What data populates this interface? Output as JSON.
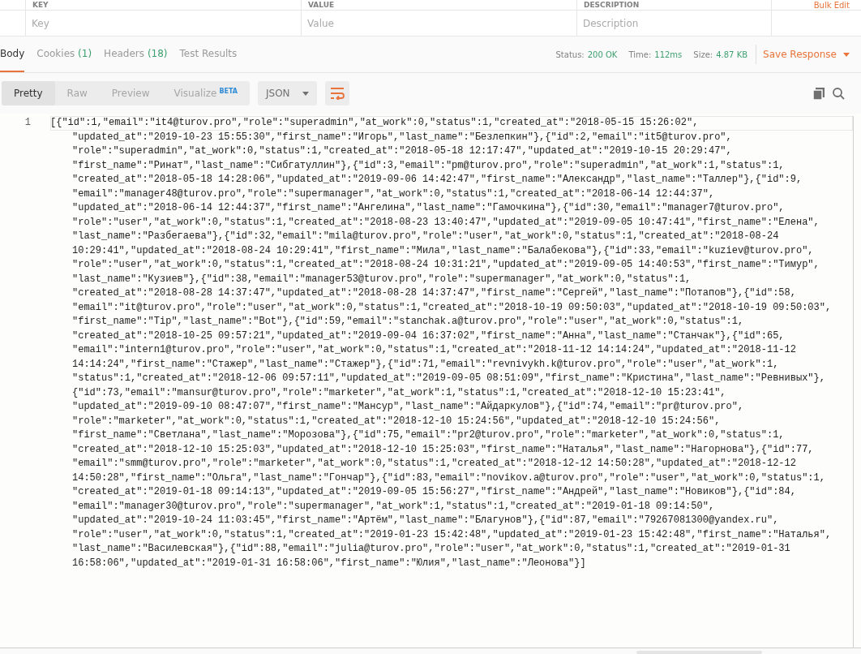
{
  "params_table": {
    "columns": [
      "KEY",
      "VALUE",
      "DESCRIPTION"
    ],
    "bulk_edit": "Bulk Edit",
    "placeholders": [
      "Key",
      "Value",
      "Description"
    ]
  },
  "response_tabs": [
    {
      "label": "Body",
      "selected": true
    },
    {
      "label": "Cookies",
      "count": "(1)",
      "selected": false
    },
    {
      "label": "Headers",
      "count": "(18)",
      "selected": false
    },
    {
      "label": "Test Results",
      "selected": false
    }
  ],
  "status": {
    "status_label": "Status:",
    "status_value": "200 OK",
    "time_label": "Time:",
    "time_value": "112ms",
    "size_label": "Size:",
    "size_value": "4.87 KB"
  },
  "save_response": "Save Response",
  "view_modes": [
    {
      "label": "Pretty",
      "selected": true
    },
    {
      "label": "Raw",
      "selected": false
    },
    {
      "label": "Preview",
      "selected": false
    },
    {
      "label": "Visualize",
      "badge": "BETA",
      "selected": false
    }
  ],
  "format": "JSON",
  "wrap_enabled": true,
  "editor": {
    "line_numbers": [
      "1"
    ],
    "lines": [
      "[{\"id\":1,\"email\":\"it4@turov.pro\",\"role\":\"superadmin\",\"at_work\":0,\"status\":1,\"created_at\":\"2018-05-15 15:26:02\",",
      "\"updated_at\":\"2019-10-23 15:55:30\",\"first_name\":\"Игорь\",\"last_name\":\"Безлепкин\"},{\"id\":2,\"email\":\"it5@turov.pro\",",
      "\"role\":\"superadmin\",\"at_work\":0,\"status\":1,\"created_at\":\"2018-05-18 12:17:47\",\"updated_at\":\"2019-10-15 20:29:47\",",
      "\"first_name\":\"Ринат\",\"last_name\":\"Сибгатуллин\"},{\"id\":3,\"email\":\"pm@turov.pro\",\"role\":\"superadmin\",\"at_work\":1,\"status\":1,",
      "\"created_at\":\"2018-05-18 14:28:06\",\"updated_at\":\"2019-09-06 14:42:47\",\"first_name\":\"Александр\",\"last_name\":\"Таллер\"},{\"id\":9,",
      "\"email\":\"manager48@turov.pro\",\"role\":\"supermanager\",\"at_work\":0,\"status\":1,\"created_at\":\"2018-06-14 12:44:37\",",
      "\"updated_at\":\"2018-06-14 12:44:37\",\"first_name\":\"Ангелина\",\"last_name\":\"Гамочкина\"},{\"id\":30,\"email\":\"manager7@turov.pro\",",
      "\"role\":\"user\",\"at_work\":0,\"status\":1,\"created_at\":\"2018-08-23 13:40:47\",\"updated_at\":\"2019-09-05 10:47:41\",\"first_name\":\"Елена\",",
      "\"last_name\":\"Разбегаева\"},{\"id\":32,\"email\":\"mila@turov.pro\",\"role\":\"user\",\"at_work\":0,\"status\":1,\"created_at\":\"2018-08-24",
      "10:29:41\",\"updated_at\":\"2018-08-24 10:29:41\",\"first_name\":\"Мила\",\"last_name\":\"Балабекова\"},{\"id\":33,\"email\":\"kuziev@turov.pro\",",
      "\"role\":\"user\",\"at_work\":0,\"status\":1,\"created_at\":\"2018-08-24 10:31:21\",\"updated_at\":\"2019-09-05 14:40:53\",\"first_name\":\"Тимур\",",
      "\"last_name\":\"Кузиев\"},{\"id\":38,\"email\":\"manager53@turov.pro\",\"role\":\"supermanager\",\"at_work\":0,\"status\":1,",
      "\"created_at\":\"2018-08-28 14:37:47\",\"updated_at\":\"2018-08-28 14:37:47\",\"first_name\":\"Сергей\",\"last_name\":\"Потапов\"},{\"id\":58,",
      "\"email\":\"it@turov.pro\",\"role\":\"user\",\"at_work\":0,\"status\":1,\"created_at\":\"2018-10-19 09:50:03\",\"updated_at\":\"2018-10-19 09:50:03\",",
      "\"first_name\":\"Tip\",\"last_name\":\"Bot\"},{\"id\":59,\"email\":\"stanchak.a@turov.pro\",\"role\":\"user\",\"at_work\":0,\"status\":1,",
      "\"created_at\":\"2018-10-25 09:57:21\",\"updated_at\":\"2019-09-04 16:37:02\",\"first_name\":\"Анна\",\"last_name\":\"Станчак\"},{\"id\":65,",
      "\"email\":\"intern1@turov.pro\",\"role\":\"user\",\"at_work\":0,\"status\":1,\"created_at\":\"2018-11-12 14:14:24\",\"updated_at\":\"2018-11-12",
      "14:14:24\",\"first_name\":\"Стажер\",\"last_name\":\"Стажер\"},{\"id\":71,\"email\":\"revnivykh.k@turov.pro\",\"role\":\"user\",\"at_work\":1,",
      "\"status\":1,\"created_at\":\"2018-12-06 09:57:11\",\"updated_at\":\"2019-09-05 08:51:09\",\"first_name\":\"Кристина\",\"last_name\":\"Ревнивых\"},",
      "{\"id\":73,\"email\":\"mansur@turov.pro\",\"role\":\"marketer\",\"at_work\":1,\"status\":1,\"created_at\":\"2018-12-10 15:23:41\",",
      "\"updated_at\":\"2019-09-10 08:47:07\",\"first_name\":\"Мансур\",\"last_name\":\"Айдаркулов\"},{\"id\":74,\"email\":\"pr@turov.pro\",",
      "\"role\":\"marketer\",\"at_work\":0,\"status\":1,\"created_at\":\"2018-12-10 15:24:56\",\"updated_at\":\"2018-12-10 15:24:56\",",
      "\"first_name\":\"Светлана\",\"last_name\":\"Морозова\"},{\"id\":75,\"email\":\"pr2@turov.pro\",\"role\":\"marketer\",\"at_work\":0,\"status\":1,",
      "\"created_at\":\"2018-12-10 15:25:03\",\"updated_at\":\"2018-12-10 15:25:03\",\"first_name\":\"Наталья\",\"last_name\":\"Нагорнова\"},{\"id\":77,",
      "\"email\":\"smm@turov.pro\",\"role\":\"marketer\",\"at_work\":0,\"status\":1,\"created_at\":\"2018-12-12 14:50:28\",\"updated_at\":\"2018-12-12",
      "14:50:28\",\"first_name\":\"Ольга\",\"last_name\":\"Гончар\"},{\"id\":83,\"email\":\"novikov.a@turov.pro\",\"role\":\"user\",\"at_work\":0,\"status\":1,",
      "\"created_at\":\"2019-01-18 09:14:13\",\"updated_at\":\"2019-09-05 15:56:27\",\"first_name\":\"Андрей\",\"last_name\":\"Новиков\"},{\"id\":84,",
      "\"email\":\"manager30@turov.pro\",\"role\":\"supermanager\",\"at_work\":1,\"status\":1,\"created_at\":\"2019-01-18 09:14:50\",",
      "\"updated_at\":\"2019-10-24 11:03:45\",\"first_name\":\"Артём\",\"last_name\":\"Благунов\"},{\"id\":87,\"email\":\"79267081300@yandex.ru\",",
      "\"role\":\"user\",\"at_work\":0,\"status\":1,\"created_at\":\"2019-01-23 15:42:48\",\"updated_at\":\"2019-01-23 15:42:48\",\"first_name\":\"Наталья\",",
      "\"last_name\":\"Василевская\"},{\"id\":88,\"email\":\"julia@turov.pro\",\"role\":\"user\",\"at_work\":0,\"status\":1,\"created_at\":\"2019-01-31",
      "16:58:06\",\"updated_at\":\"2019-01-31 16:58:06\",\"first_name\":\"Юлия\",\"last_name\":\"Леонова\"}]"
    ]
  }
}
